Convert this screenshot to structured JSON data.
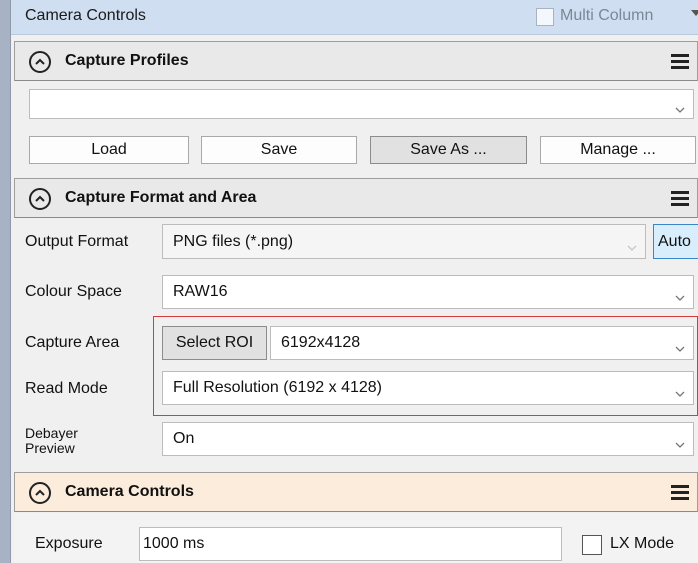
{
  "panel": {
    "title": "Camera Controls",
    "multi_column_label": "Multi Column"
  },
  "capture_profiles": {
    "title": "Capture Profiles",
    "selected_profile": "",
    "buttons": {
      "load": "Load",
      "save": "Save",
      "save_as": "Save As ...",
      "manage": "Manage ..."
    }
  },
  "capture_format": {
    "title": "Capture Format and Area",
    "output_format": {
      "label": "Output Format",
      "value": "PNG files (*.png)",
      "auto_button": "Auto"
    },
    "colour_space": {
      "label": "Colour Space",
      "value": "RAW16"
    },
    "capture_area": {
      "label": "Capture Area",
      "select_roi_button": "Select ROI",
      "value": "6192x4128"
    },
    "read_mode": {
      "label": "Read Mode",
      "value": "Full Resolution (6192 x 4128)"
    },
    "debayer_preview": {
      "label_line1": "Debayer",
      "label_line2": "Preview",
      "value": "On"
    }
  },
  "camera_controls": {
    "title": "Camera Controls",
    "exposure": {
      "label": "Exposure",
      "value": "1000 ms"
    },
    "lx_mode_label": "LX Mode"
  },
  "colors": {
    "highlight_border": "#d93b3b",
    "title_bar_bg": "#cfdef0",
    "camera_controls_header_bg": "#fbecdc"
  }
}
